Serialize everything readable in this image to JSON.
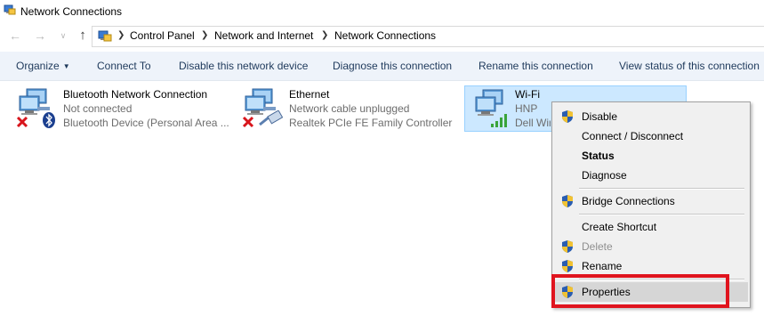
{
  "window": {
    "title": "Network Connections"
  },
  "address": {
    "crumbs": [
      "Control Panel",
      "Network and Internet",
      "Network Connections"
    ]
  },
  "toolbar": {
    "organize": "Organize",
    "connect_to": "Connect To",
    "disable_device": "Disable this network device",
    "diagnose": "Diagnose this connection",
    "rename": "Rename this connection",
    "view_status": "View status of this connection"
  },
  "connections": [
    {
      "name": "Bluetooth Network Connection",
      "status": "Not connected",
      "device": "Bluetooth Device (Personal Area ...",
      "icon": "bluetooth-network-icon",
      "badge": "red-x",
      "selected": false
    },
    {
      "name": "Ethernet",
      "status": "Network cable unplugged",
      "device": "Realtek PCIe FE Family Controller",
      "icon": "ethernet-network-icon",
      "badge": "red-x",
      "selected": false
    },
    {
      "name": "Wi-Fi",
      "status": "HNP",
      "device": "Dell Wir",
      "icon": "wifi-network-icon",
      "badge": "signal-bars",
      "selected": true
    }
  ],
  "context_menu": {
    "items": [
      {
        "label": "Disable",
        "shield": true,
        "bold": false,
        "disabled": false
      },
      {
        "label": "Connect / Disconnect",
        "shield": false,
        "bold": false,
        "disabled": false
      },
      {
        "label": "Status",
        "shield": false,
        "bold": true,
        "disabled": false
      },
      {
        "label": "Diagnose",
        "shield": false,
        "bold": false,
        "disabled": false
      },
      {
        "label": "Bridge Connections",
        "shield": true,
        "bold": false,
        "disabled": false
      },
      {
        "label": "Create Shortcut",
        "shield": false,
        "bold": false,
        "disabled": false
      },
      {
        "label": "Delete",
        "shield": true,
        "bold": false,
        "disabled": true
      },
      {
        "label": "Rename",
        "shield": true,
        "bold": false,
        "disabled": false
      },
      {
        "label": "Properties",
        "shield": true,
        "bold": false,
        "disabled": false,
        "hovered": true
      }
    ]
  },
  "colors": {
    "accent_highlight": "#e0141e",
    "selection": "#cce8ff",
    "toolbar_bg": "#eef3fa",
    "command_text": "#1e395b"
  }
}
